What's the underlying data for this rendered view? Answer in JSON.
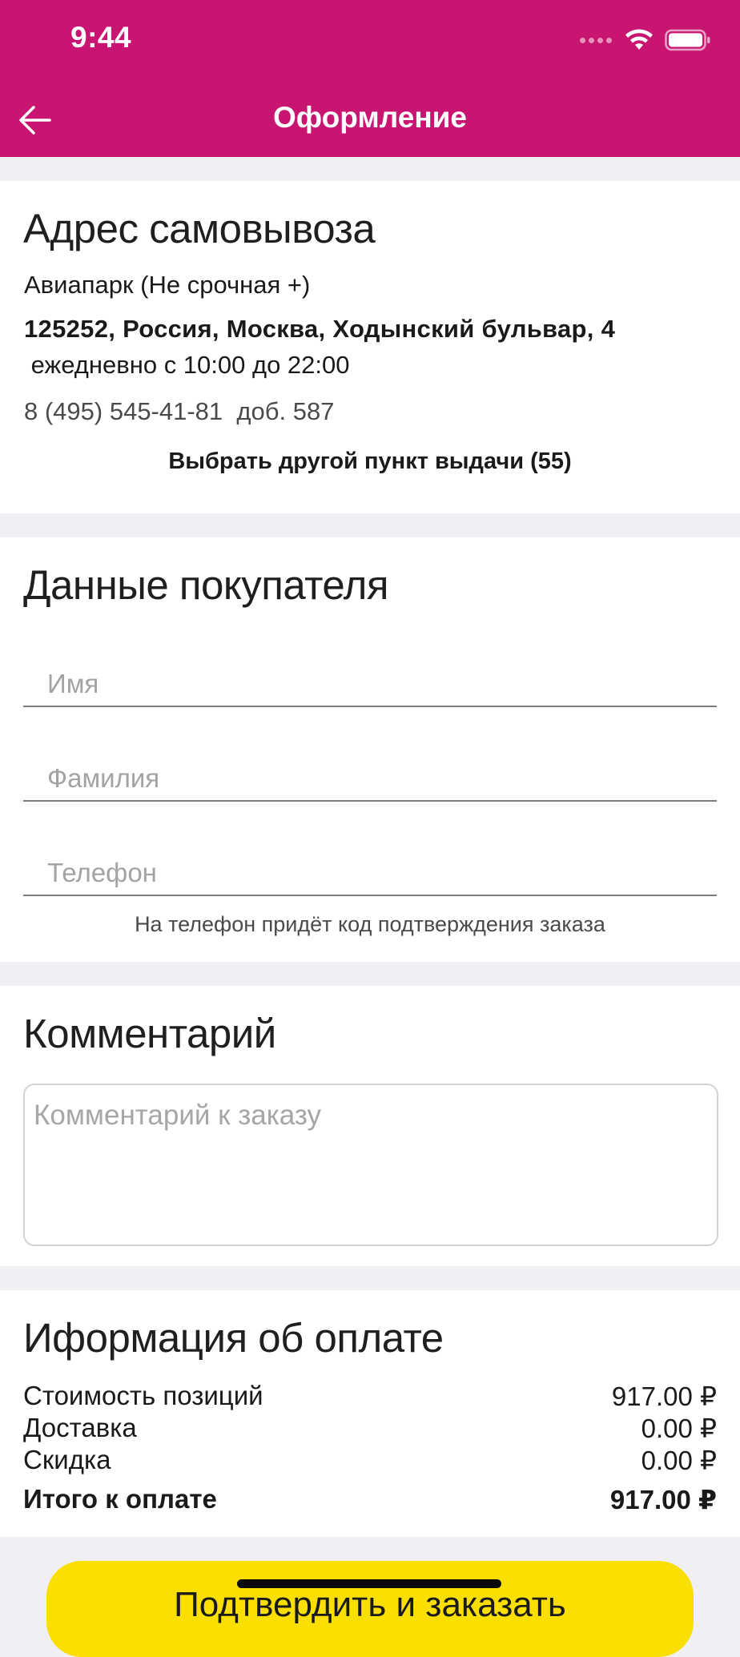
{
  "status_bar": {
    "time": "9:44"
  },
  "header": {
    "title": "Оформление"
  },
  "pickup": {
    "title": "Адрес самовывоза",
    "store_name": "Авиапарк (Не срочная +)",
    "address": "125252, Россия, Москва, Ходынский бульвар, 4",
    "hours": " ежедневно с 10:00 до 22:00",
    "phone": "8 (495) 545-41-81  доб. 587",
    "change_link": "Выбрать другой пункт выдачи (55)"
  },
  "buyer": {
    "title": "Данные покупателя",
    "first_name_placeholder": "Имя",
    "last_name_placeholder": "Фамилия",
    "phone_placeholder": "Телефон",
    "phone_hint": "На телефон придёт код подтверждения заказа"
  },
  "comment": {
    "title": "Комментарий",
    "placeholder": "Комментарий к заказу"
  },
  "payment": {
    "title": "Иформация об оплате",
    "rows": [
      {
        "label": "Стоимость позиций",
        "value": "917.00 ₽"
      },
      {
        "label": "Доставка",
        "value": "0.00 ₽"
      },
      {
        "label": "Скидка",
        "value": "0.00 ₽"
      },
      {
        "label": "Итого к оплате",
        "value": "917.00 ₽"
      }
    ]
  },
  "confirm_button": {
    "label": "Подтвердить и заказать"
  },
  "colors": {
    "brand": "#c71571",
    "accent": "#fadf00",
    "background": "#efeff4"
  }
}
